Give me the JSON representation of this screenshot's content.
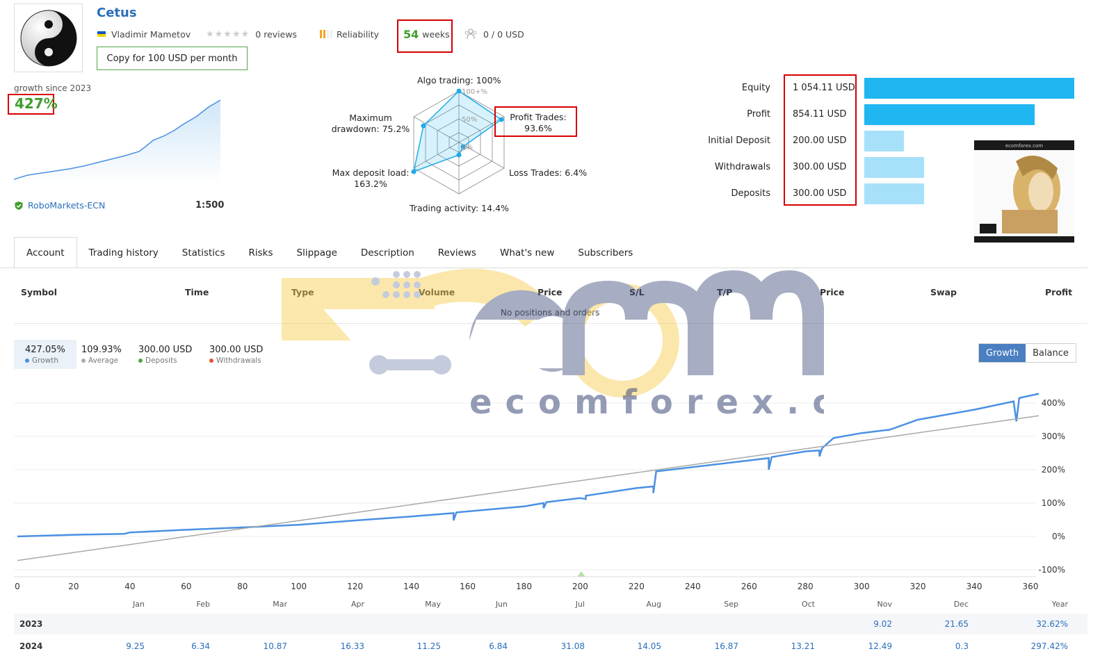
{
  "header": {
    "title": "Cetus",
    "author": "Vladimir Mametov",
    "reviews": "0 reviews",
    "reliability": "Reliability",
    "weeks_num": "54",
    "weeks_label": "weeks",
    "subscribers": "0 / 0 USD",
    "copy_button": "Copy for 100 USD per month"
  },
  "summary": {
    "growth_label": "growth since 2023",
    "growth_value": "427%",
    "broker": "RoboMarkets-ECN",
    "leverage": "1:500"
  },
  "radar": {
    "algo": "Algo trading: 100%",
    "profit_trades_a": "Profit Trades:",
    "profit_trades_b": "93.6%",
    "loss_trades": "Loss Trades: 6.4%",
    "trading_activity": "Trading activity: 14.4%",
    "max_deposit_a": "Max deposit load:",
    "max_deposit_b": "163.2%",
    "max_drawdown_a": "Maximum",
    "max_drawdown_b": "drawdown: 75.2%",
    "ring_100": "100+%",
    "ring_50": "50%",
    "ring_0": "0%"
  },
  "equity": [
    {
      "label": "Equity",
      "value": "1 054.11 USD",
      "ratio": 1.0,
      "color": "#1fb6f1"
    },
    {
      "label": "Profit",
      "value": "854.11 USD",
      "ratio": 0.81,
      "color": "#1fb6f1"
    },
    {
      "label": "Initial Deposit",
      "value": "200.00 USD",
      "ratio": 0.19,
      "color": "#a6e1f9"
    },
    {
      "label": "Withdrawals",
      "value": "300.00 USD",
      "ratio": 0.285,
      "color": "#a6e1f9"
    },
    {
      "label": "Deposits",
      "value": "300.00 USD",
      "ratio": 0.285,
      "color": "#a6e1f9"
    }
  ],
  "ad": {
    "site": "ecomforex.com"
  },
  "tabs": [
    "Account",
    "Trading history",
    "Statistics",
    "Risks",
    "Slippage",
    "Description",
    "Reviews",
    "What's new",
    "Subscribers"
  ],
  "positions": {
    "headers": [
      "Symbol",
      "Time",
      "Type",
      "Volume",
      "Price",
      "S/L",
      "T/P",
      "Price",
      "Swap",
      "Profit"
    ],
    "empty": "No positions and orders"
  },
  "stats": [
    {
      "value": "427.05%",
      "label": "Growth",
      "color": "#4a90e2"
    },
    {
      "value": "109.93%",
      "label": "Average",
      "color": "#aaaaaa"
    },
    {
      "value": "300.00 USD",
      "label": "Deposits",
      "color": "#52a645"
    },
    {
      "value": "300.00 USD",
      "label": "Withdrawals",
      "color": "#e8552d"
    }
  ],
  "toggle": {
    "growth": "Growth",
    "balance": "Balance"
  },
  "watermark": {
    "text": "ecomforex.com"
  },
  "chart_data": {
    "type": "line",
    "x_ticks": [
      "0",
      "20",
      "40",
      "60",
      "80",
      "100",
      "120",
      "140",
      "160",
      "180",
      "200",
      "220",
      "240",
      "260",
      "280",
      "300",
      "320",
      "340",
      "360"
    ],
    "y_ticks": [
      "400%",
      "300%",
      "200%",
      "100%",
      "0%",
      "-100%"
    ],
    "xlim": [
      0,
      360
    ],
    "ylim": [
      -100,
      400
    ],
    "series": [
      {
        "values": [
          [
            0,
            0
          ],
          [
            20,
            5
          ],
          [
            38,
            8
          ],
          [
            40,
            12
          ],
          [
            60,
            20
          ],
          [
            80,
            27
          ],
          [
            100,
            35
          ],
          [
            120,
            48
          ],
          [
            140,
            60
          ],
          [
            155,
            70
          ],
          [
            155,
            48
          ],
          [
            156,
            72
          ],
          [
            180,
            90
          ],
          [
            187,
            100
          ],
          [
            187,
            85
          ],
          [
            188,
            103
          ],
          [
            200,
            115
          ],
          [
            202,
            112
          ],
          [
            202,
            122
          ],
          [
            220,
            145
          ],
          [
            226,
            150
          ],
          [
            226,
            130
          ],
          [
            227,
            195
          ],
          [
            260,
            228
          ],
          [
            267,
            235
          ],
          [
            267,
            200
          ],
          [
            268,
            238
          ],
          [
            280,
            255
          ],
          [
            285,
            258
          ],
          [
            285,
            240
          ],
          [
            286,
            265
          ],
          [
            290,
            295
          ],
          [
            300,
            310
          ],
          [
            310,
            320
          ],
          [
            320,
            350
          ],
          [
            340,
            380
          ],
          [
            354,
            405
          ],
          [
            355,
            345
          ],
          [
            356,
            415
          ],
          [
            363,
            428
          ]
        ]
      },
      {
        "values": [
          [
            0,
            -72
          ],
          [
            363,
            362
          ]
        ]
      }
    ]
  },
  "months": [
    "Jan",
    "Feb",
    "Mar",
    "Apr",
    "May",
    "Jun",
    "Jul",
    "Aug",
    "Sep",
    "Oct",
    "Nov",
    "Dec",
    "Year"
  ],
  "yearly": [
    {
      "year": "2023",
      "cells": [
        "",
        "",
        "",
        "",
        "",
        "",
        "",
        "",
        "",
        "",
        "9.02",
        "21.65",
        "32.62%"
      ]
    },
    {
      "year": "2024",
      "cells": [
        "9.25",
        "6.34",
        "10.87",
        "16.33",
        "11.25",
        "6.84",
        "31.08",
        "14.05",
        "16.87",
        "13.21",
        "12.49",
        "0.3",
        "297.42%"
      ]
    }
  ]
}
